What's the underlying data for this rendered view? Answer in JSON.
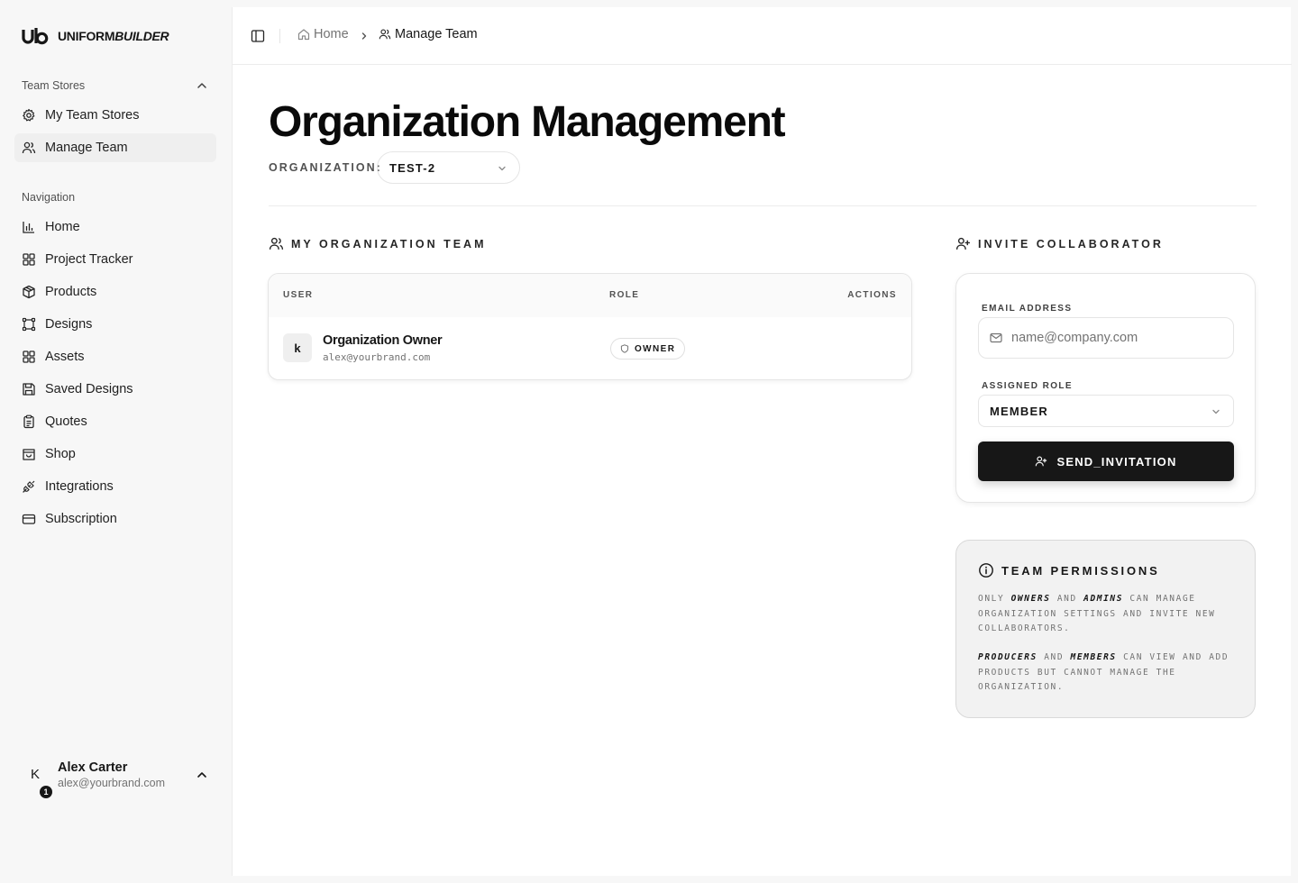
{
  "brand": {
    "logo_mark": "ub",
    "name_bold": "UNIFORM",
    "name_italic": "BUILDER"
  },
  "sidebar": {
    "groups": [
      {
        "label": "Team Stores",
        "items": [
          {
            "label": "My Team Stores",
            "icon": "gear-icon"
          },
          {
            "label": "Manage Team",
            "icon": "users-icon",
            "active": true
          }
        ]
      },
      {
        "label": "Navigation",
        "items": [
          {
            "label": "Home",
            "icon": "bar-chart-icon"
          },
          {
            "label": "Project Tracker",
            "icon": "grid-icon"
          },
          {
            "label": "Products",
            "icon": "package-icon"
          },
          {
            "label": "Designs",
            "icon": "vector-square-icon"
          },
          {
            "label": "Assets",
            "icon": "grid-icon"
          },
          {
            "label": "Saved Designs",
            "icon": "save-icon"
          },
          {
            "label": "Quotes",
            "icon": "clipboard-icon"
          },
          {
            "label": "Shop",
            "icon": "store-icon"
          },
          {
            "label": "Integrations",
            "icon": "plug-icon"
          },
          {
            "label": "Subscription",
            "icon": "credit-card-icon"
          }
        ]
      }
    ],
    "user": {
      "avatar_letter": "K",
      "badge": "1",
      "name": "Alex Carter",
      "email": "alex@yourbrand.com"
    }
  },
  "breadcrumb": [
    {
      "label": "Home",
      "icon": "home-icon"
    },
    {
      "label": "Manage Team",
      "icon": "users-icon"
    }
  ],
  "page": {
    "title": "Organization Management",
    "org_label": "ORGANIZATION:",
    "org_value": "TEST-2"
  },
  "team": {
    "section_title": "MY ORGANIZATION TEAM",
    "columns": [
      "USER",
      "ROLE",
      "ACTIONS"
    ],
    "rows": [
      {
        "avatar": "k",
        "name": "Organization Owner",
        "email": "alex@yourbrand.com",
        "role": "OWNER"
      }
    ]
  },
  "invite": {
    "section_title": "INVITE COLLABORATOR",
    "email_label": "EMAIL ADDRESS",
    "email_placeholder": "name@company.com",
    "role_label": "ASSIGNED ROLE",
    "role_value": "MEMBER",
    "send_label": "SEND_INVITATION"
  },
  "permissions": {
    "title": "TEAM PERMISSIONS",
    "p1": {
      "pre": "ONLY ",
      "b1": "OWNERS",
      "mid": " AND ",
      "b2": "ADMINS",
      "post": " CAN MANAGE ORGANIZATION SETTINGS AND INVITE NEW COLLABORATORS."
    },
    "p2": {
      "b1": "PRODUCERS",
      "mid": " AND ",
      "b2": "MEMBERS",
      "post": " CAN VIEW AND ADD PRODUCTS BUT CANNOT MANAGE THE ORGANIZATION."
    }
  }
}
